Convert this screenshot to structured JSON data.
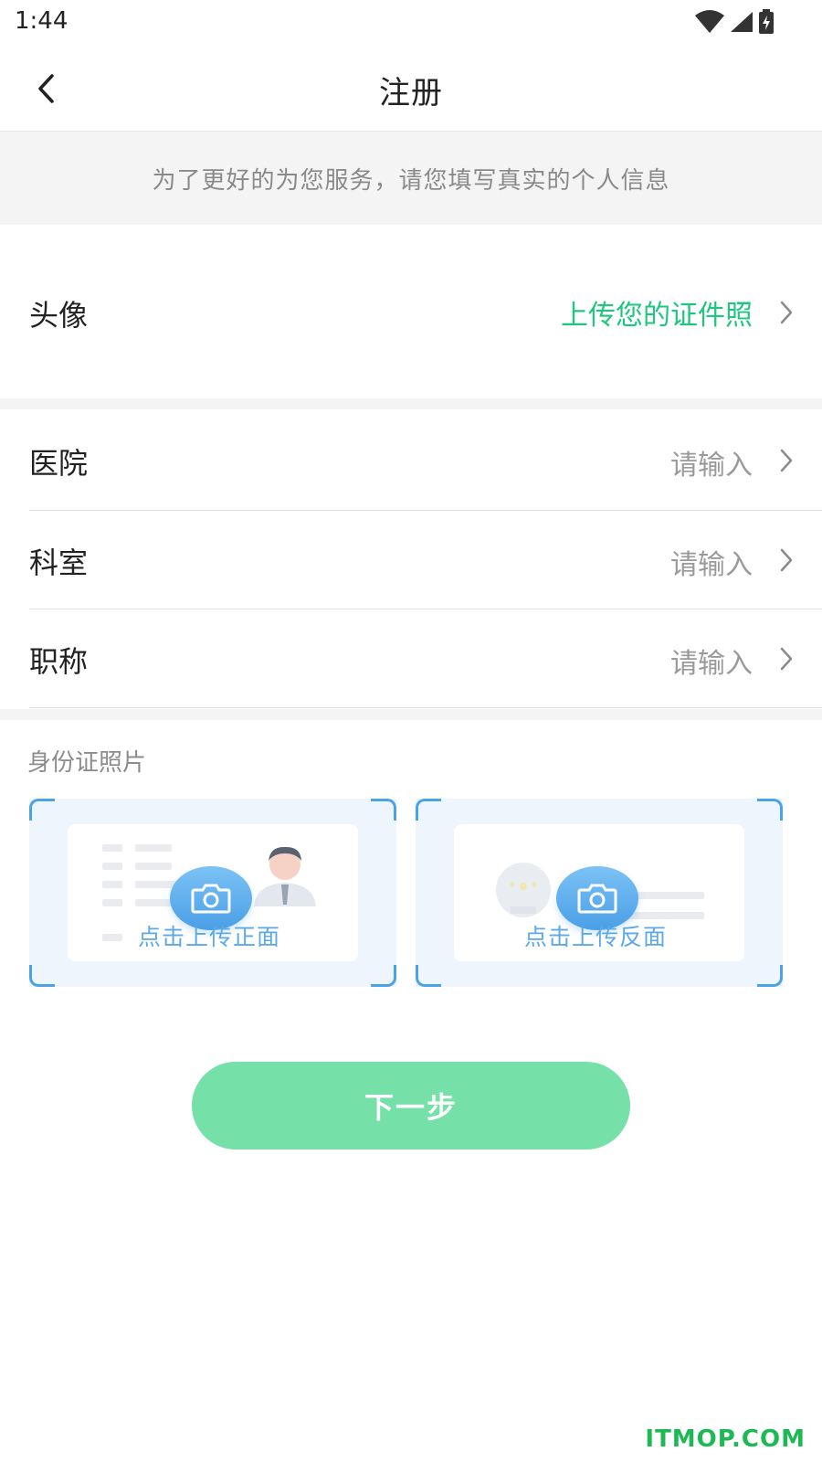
{
  "status_bar": {
    "time": "1:44",
    "icons": [
      "wifi-icon",
      "signal-icon",
      "battery-charging-icon"
    ]
  },
  "nav": {
    "title": "注册",
    "back_icon": "chevron-left-icon"
  },
  "notice": "为了更好的为您服务，请您填写真实的个人信息",
  "avatar_row": {
    "label": "头像",
    "value": "上传您的证件照",
    "value_color": "#1ec77e"
  },
  "fields": [
    {
      "label": "医院",
      "placeholder": "请输入"
    },
    {
      "label": "科室",
      "placeholder": "请输入"
    },
    {
      "label": "职称",
      "placeholder": "请输入"
    }
  ],
  "id_section": {
    "title": "身份证照片",
    "front_caption": "点击上传正面",
    "back_caption": "点击上传反面"
  },
  "next_button": {
    "label": "下一步",
    "color": "#76e0a9"
  },
  "watermark": "ITMOP.COM",
  "colors": {
    "accent_green": "#1ec77e",
    "upload_blue": "#4aa3e6"
  }
}
